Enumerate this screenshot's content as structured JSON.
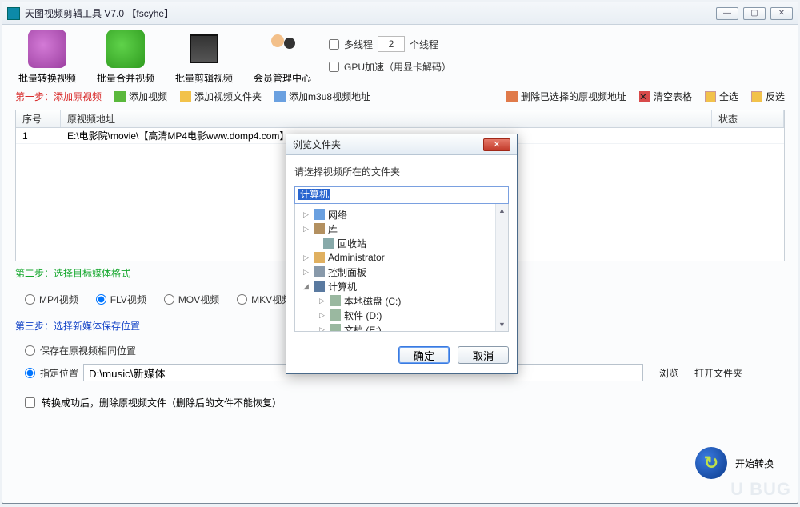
{
  "window": {
    "title": "天图视频剪辑工具 V7.0   【fscyhe】"
  },
  "toolbar": {
    "convert": "批量转换视频",
    "merge": "批量合并视频",
    "clip": "批量剪辑视频",
    "member": "会员管理中心",
    "multithread_label": "多线程",
    "thread_count": "2",
    "thread_unit": "个线程",
    "gpu_label": "GPU加速（用显卡解码）"
  },
  "actions": {
    "step1": "第一步：添加原视频",
    "add_video": "添加视频",
    "add_folder": "添加视频文件夹",
    "add_m3u8": "添加m3u8视频地址",
    "delete_selected": "删除已选择的原视频地址",
    "clear_table": "清空表格",
    "select_all": "全选",
    "invert_select": "反选"
  },
  "table": {
    "col_index": "序号",
    "col_path": "原视频地址",
    "col_status": "状态",
    "rows": [
      {
        "index": "1",
        "path": "E:\\电影院\\movie\\【高清MP4电影www.domp4.com】",
        "status": ""
      }
    ]
  },
  "step2": {
    "title": "第二步：选择目标媒体格式",
    "mp4": "MP4视频",
    "flv": "FLV视频",
    "mov": "MOV视频",
    "mkv": "MKV视频"
  },
  "step3": {
    "title": "第三步：选择新媒体保存位置",
    "same_loc": "保存在原视频相同位置",
    "spec_loc": "指定位置",
    "path": "D:\\music\\新媒体",
    "browse": "浏览",
    "open_folder": "打开文件夹"
  },
  "bottom": {
    "delete_after": "转换成功后，删除原视频文件（删除后的文件不能恢复）",
    "start": "开始转换"
  },
  "dialog": {
    "title": "浏览文件夹",
    "prompt": "请选择视频所在的文件夹",
    "input_value": "计算机",
    "tree": {
      "network": "网络",
      "library": "库",
      "recycle": "回收站",
      "admin": "Administrator",
      "control": "控制面板",
      "computer": "计算机",
      "drive_c": "本地磁盘 (C:)",
      "drive_d": "软件 (D:)",
      "drive_e": "文档 (E:)"
    },
    "ok": "确定",
    "cancel": "取消"
  },
  "watermark": "U BUG"
}
